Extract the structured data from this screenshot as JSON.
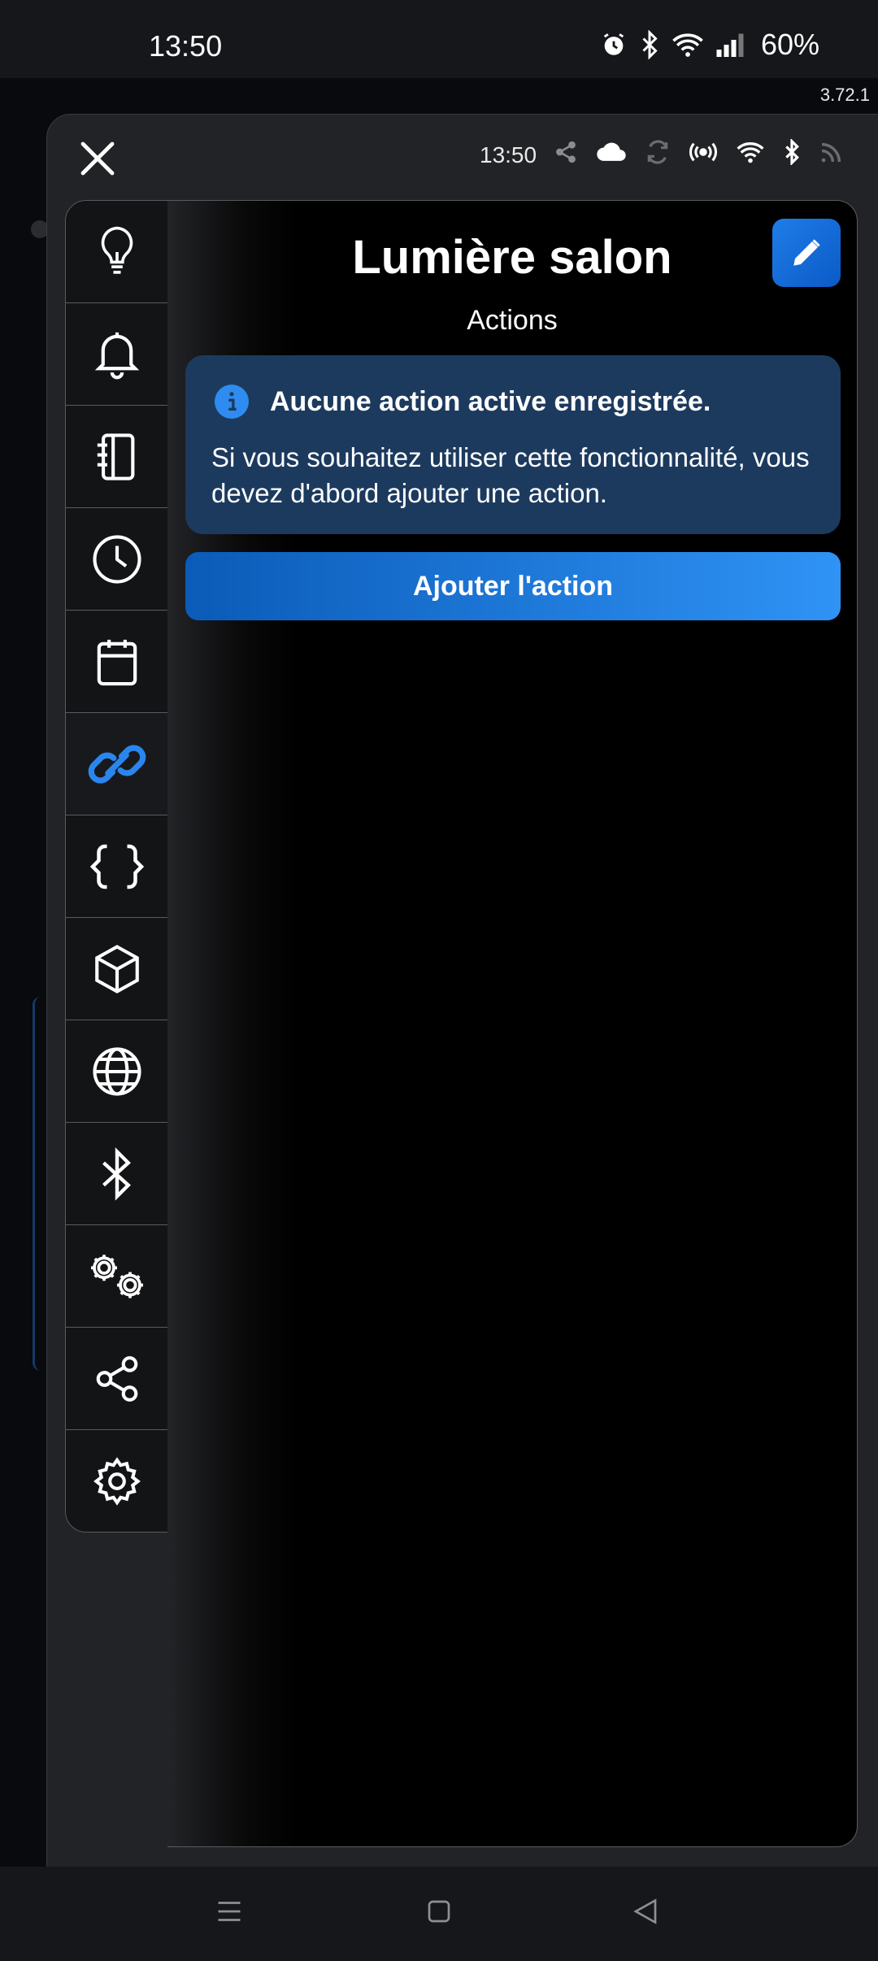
{
  "status_bar": {
    "time": "13:50",
    "battery": "60%",
    "icons": [
      "alarm-icon",
      "bluetooth-icon",
      "wifi-icon",
      "signal-icon"
    ]
  },
  "app_version": "3.72.1",
  "dialog": {
    "time": "13:50",
    "status_icons": [
      "share-icon",
      "cloud-icon",
      "sync-icon",
      "broadcast-icon",
      "wifi-icon",
      "bluetooth-icon",
      "rss-icon"
    ]
  },
  "sidebar": {
    "items": [
      {
        "icon": "lightbulb-icon"
      },
      {
        "icon": "bell-icon"
      },
      {
        "icon": "notebook-icon"
      },
      {
        "icon": "clock-icon"
      },
      {
        "icon": "calendar-icon"
      },
      {
        "icon": "link-icon",
        "active": true
      },
      {
        "icon": "braces-icon"
      },
      {
        "icon": "cube-icon"
      },
      {
        "icon": "globe-icon"
      },
      {
        "icon": "bluetooth-icon"
      },
      {
        "icon": "gears-icon"
      },
      {
        "icon": "share-icon"
      },
      {
        "icon": "settings-icon"
      }
    ]
  },
  "panel": {
    "title": "Lumière salon",
    "subtitle": "Actions",
    "alert": {
      "title": "Aucune action active enregistrée.",
      "body": "Si vous souhaitez utiliser cette fonctionnalité, vous devez d'abord ajouter une action."
    },
    "add_button": "Ajouter l'action"
  },
  "colors": {
    "accent": "#2e8cf0",
    "alert_bg": "#1c3a5e",
    "active_icon": "#2a86ee"
  }
}
